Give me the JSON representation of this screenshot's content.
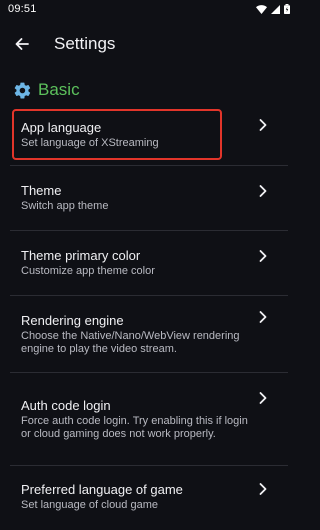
{
  "status": {
    "time": "09:51"
  },
  "appbar": {
    "title": "Settings"
  },
  "section": {
    "title": "Basic"
  },
  "items": [
    {
      "label": "App language",
      "desc": "Set language of XStreaming"
    },
    {
      "label": "Theme",
      "desc": "Switch app theme"
    },
    {
      "label": "Theme primary color",
      "desc": "Customize app theme color"
    },
    {
      "label": "Rendering engine",
      "desc": "Choose the Native/Nano/WebView rendering engine to play the video stream."
    },
    {
      "label": "Auth code login",
      "desc": "Force auth code login. Try enabling this if login or cloud gaming does not work properly."
    },
    {
      "label": "Preferred language of game",
      "desc": "Set language of cloud game"
    }
  ],
  "colors": {
    "accent": "#5cc05c",
    "highlight": "#e2352a",
    "background": "#0f1015"
  },
  "icons": {
    "back": "arrow-left-icon",
    "section": "gear-icon",
    "chevron": "chevron-right-icon"
  }
}
